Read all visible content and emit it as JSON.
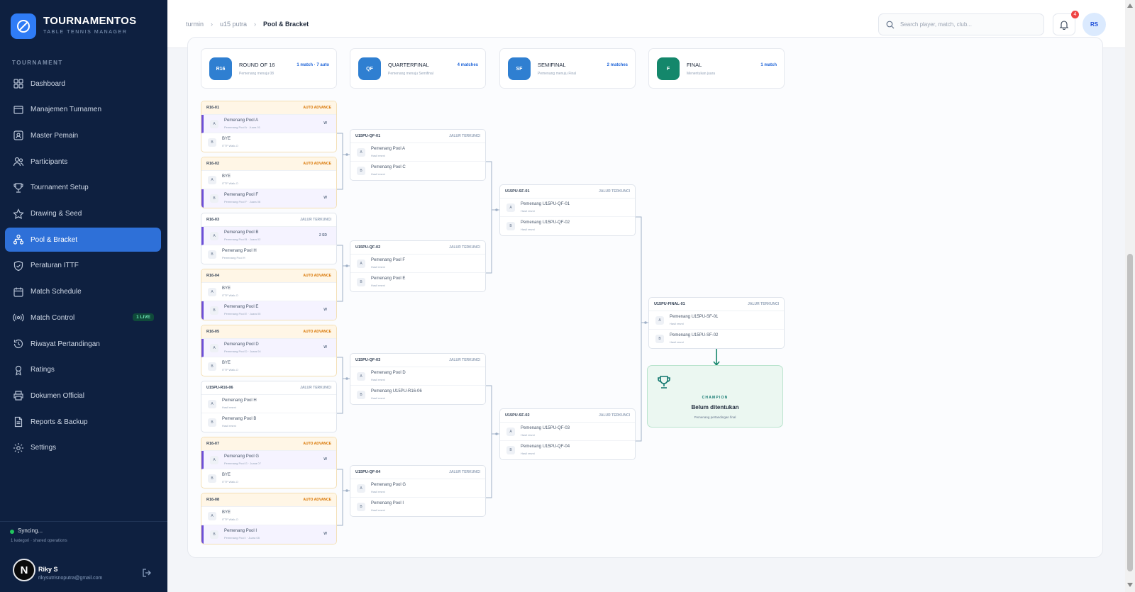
{
  "app": {
    "name": "TOURNAMENTOS",
    "subtitle": "TABLE TENNIS MANAGER"
  },
  "sidebar": {
    "section_label": "TOURNAMENT",
    "items": [
      {
        "label": "Dashboard",
        "icon": "grid-icon"
      },
      {
        "label": "Manajemen Turnamen",
        "icon": "inbox-icon"
      },
      {
        "label": "Master Pemain",
        "icon": "id-card-icon"
      },
      {
        "label": "Participants",
        "icon": "users-icon"
      },
      {
        "label": "Tournament Setup",
        "icon": "trophy-icon"
      },
      {
        "label": "Drawing & Seed",
        "icon": "star-icon"
      },
      {
        "label": "Pool & Bracket",
        "icon": "bracket-icon",
        "active": true
      },
      {
        "label": "Peraturan ITTF",
        "icon": "shield-icon"
      },
      {
        "label": "Match Schedule",
        "icon": "calendar-icon"
      },
      {
        "label": "Match Control",
        "icon": "broadcast-icon",
        "badge": "1 LIVE"
      },
      {
        "label": "Riwayat Pertandingan",
        "icon": "history-icon"
      },
      {
        "label": "Ratings",
        "icon": "medal-icon"
      },
      {
        "label": "Dokumen Official",
        "icon": "printer-icon"
      },
      {
        "label": "Reports & Backup",
        "icon": "file-icon"
      },
      {
        "label": "Settings",
        "icon": "gear-icon"
      }
    ],
    "sync": {
      "status": "Syncing...",
      "detail": "1 kategori · shared operations"
    },
    "user": {
      "initial": "N",
      "name": "Riky S",
      "email": "rikysutrisnoputra@gmail.com"
    }
  },
  "topbar": {
    "breadcrumb": [
      "turmin",
      "u15 putra",
      "Pool & Bracket"
    ],
    "search_placeholder": "Search player, match, club...",
    "notification_count": "4",
    "avatar_initials": "RS"
  },
  "rounds": [
    {
      "code": "R16",
      "title": "ROUND OF 16",
      "subtitle": "Pemenang menuju 08",
      "count": "1 match · 7 auto",
      "color": "#2f7fd1"
    },
    {
      "code": "QF",
      "title": "QUARTERFINAL",
      "subtitle": "Pemenang menuju Semifinal",
      "count": "4 matches",
      "color": "#2f7fd1"
    },
    {
      "code": "SF",
      "title": "SEMIFINAL",
      "subtitle": "Pemenang menuju Final",
      "count": "2 matches",
      "color": "#2f7fd1"
    },
    {
      "code": "F",
      "title": "FINAL",
      "subtitle": "Menentukan juara",
      "count": "1 match",
      "color": "#14876b"
    }
  ],
  "matches": {
    "r16": [
      {
        "id": "R16-01",
        "tag": "AUTO ADVANCE",
        "auto": true,
        "slots": [
          {
            "seed": "A",
            "name": "Pemenang Pool A",
            "note": "Pemenang Pool A · Juara 01",
            "score": "W",
            "win": true
          },
          {
            "seed": "B",
            "name": "BYE",
            "note": "ITTF Walk-O",
            "score": "",
            "win": false
          }
        ]
      },
      {
        "id": "R16-02",
        "tag": "AUTO ADVANCE",
        "auto": true,
        "slots": [
          {
            "seed": "A",
            "name": "BYE",
            "note": "ITTF Walk-O",
            "score": "",
            "win": false
          },
          {
            "seed": "B",
            "name": "Pemenang Pool F",
            "note": "Pemenang Pool F · Juara 06",
            "score": "W",
            "win": true
          }
        ]
      },
      {
        "id": "R16-03",
        "tag": "JALUR TERKUNCI",
        "auto": false,
        "slots": [
          {
            "seed": "A",
            "name": "Pemenang Pool B",
            "note": "Pemenang Pool B · Juara 02",
            "score": "2 SD",
            "win": true
          },
          {
            "seed": "B",
            "name": "Pemenang Pool H",
            "note": "Pemenang Pool H",
            "score": "",
            "win": false
          }
        ]
      },
      {
        "id": "R16-04",
        "tag": "AUTO ADVANCE",
        "auto": true,
        "slots": [
          {
            "seed": "A",
            "name": "BYE",
            "note": "ITTF Walk-O",
            "score": "",
            "win": false
          },
          {
            "seed": "B",
            "name": "Pemenang Pool E",
            "note": "Pemenang Pool E · Juara 05",
            "score": "W",
            "win": true
          }
        ]
      },
      {
        "id": "R16-05",
        "tag": "AUTO ADVANCE",
        "auto": true,
        "slots": [
          {
            "seed": "A",
            "name": "Pemenang Pool D",
            "note": "Pemenang Pool D · Juara 04",
            "score": "W",
            "win": true
          },
          {
            "seed": "B",
            "name": "BYE",
            "note": "ITTF Walk-O",
            "score": "",
            "win": false
          }
        ]
      },
      {
        "id": "U15PU-R16-06",
        "tag": "JALUR TERKUNCI",
        "auto": false,
        "slots": [
          {
            "seed": "A",
            "name": "Pemenang Pool H",
            "note": "Hasil resmi",
            "score": "",
            "win": false
          },
          {
            "seed": "B",
            "name": "Pemenang Pool B",
            "note": "Hasil resmi",
            "score": "",
            "win": false
          }
        ]
      },
      {
        "id": "R16-07",
        "tag": "AUTO ADVANCE",
        "auto": true,
        "slots": [
          {
            "seed": "A",
            "name": "Pemenang Pool G",
            "note": "Pemenang Pool G · Juara 07",
            "score": "W",
            "win": true
          },
          {
            "seed": "B",
            "name": "BYE",
            "note": "ITTF Walk-O",
            "score": "",
            "win": false
          }
        ]
      },
      {
        "id": "R16-08",
        "tag": "AUTO ADVANCE",
        "auto": true,
        "slots": [
          {
            "seed": "A",
            "name": "BYE",
            "note": "ITTF Walk-O",
            "score": "",
            "win": false
          },
          {
            "seed": "B",
            "name": "Pemenang Pool I",
            "note": "Pemenang Pool I · Juara 08",
            "score": "W",
            "win": true
          }
        ]
      }
    ],
    "qf": [
      {
        "id": "U15PU-QF-01",
        "tag": "JALUR TERKUNCI",
        "auto": false,
        "slots": [
          {
            "seed": "A",
            "name": "Pemenang Pool A",
            "note": "Hasil resmi",
            "score": "",
            "win": false
          },
          {
            "seed": "B",
            "name": "Pemenang Pool C",
            "note": "Hasil resmi",
            "score": "",
            "win": false
          }
        ]
      },
      {
        "id": "U15PU-QF-02",
        "tag": "JALUR TERKUNCI",
        "auto": false,
        "slots": [
          {
            "seed": "A",
            "name": "Pemenang Pool F",
            "note": "Hasil resmi",
            "score": "",
            "win": false
          },
          {
            "seed": "B",
            "name": "Pemenang Pool E",
            "note": "Hasil resmi",
            "score": "",
            "win": false
          }
        ]
      },
      {
        "id": "U15PU-QF-03",
        "tag": "JALUR TERKUNCI",
        "auto": false,
        "slots": [
          {
            "seed": "A",
            "name": "Pemenang Pool D",
            "note": "Hasil resmi",
            "score": "",
            "win": false
          },
          {
            "seed": "B",
            "name": "Pemenang U15PU-R16-06",
            "note": "Hasil resmi",
            "score": "",
            "win": false
          }
        ]
      },
      {
        "id": "U15PU-QF-04",
        "tag": "JALUR TERKUNCI",
        "auto": false,
        "slots": [
          {
            "seed": "A",
            "name": "Pemenang Pool G",
            "note": "Hasil resmi",
            "score": "",
            "win": false
          },
          {
            "seed": "B",
            "name": "Pemenang Pool I",
            "note": "Hasil resmi",
            "score": "",
            "win": false
          }
        ]
      }
    ],
    "sf": [
      {
        "id": "U15PU-SF-01",
        "tag": "JALUR TERKUNCI",
        "auto": false,
        "slots": [
          {
            "seed": "A",
            "name": "Pemenang U15PU-QF-01",
            "note": "Hasil resmi",
            "score": "",
            "win": false
          },
          {
            "seed": "B",
            "name": "Pemenang U15PU-QF-02",
            "note": "Hasil resmi",
            "score": "",
            "win": false
          }
        ]
      },
      {
        "id": "U15PU-SF-02",
        "tag": "JALUR TERKUNCI",
        "auto": false,
        "slots": [
          {
            "seed": "A",
            "name": "Pemenang U15PU-QF-03",
            "note": "Hasil resmi",
            "score": "",
            "win": false
          },
          {
            "seed": "B",
            "name": "Pemenang U15PU-QF-04",
            "note": "Hasil resmi",
            "score": "",
            "win": false
          }
        ]
      }
    ],
    "final": [
      {
        "id": "U15PU-FINAL-01",
        "tag": "JALUR TERKUNCI",
        "auto": false,
        "slots": [
          {
            "seed": "A",
            "name": "Pemenang U15PU-SF-01",
            "note": "Hasil resmi",
            "score": "",
            "win": false
          },
          {
            "seed": "B",
            "name": "Pemenang U15PU-SF-02",
            "note": "Hasil resmi",
            "score": "",
            "win": false
          }
        ]
      }
    ]
  },
  "champion": {
    "label": "CHAMPION",
    "status": "Belum ditentukan",
    "subtitle": "Pemenang pertandingan final"
  },
  "colors": {
    "sidebar_bg": "#0e2040",
    "accent": "#2e70d8",
    "win_accent": "#6d4fd8",
    "auto_tag": "#d97706",
    "final": "#14876b"
  }
}
